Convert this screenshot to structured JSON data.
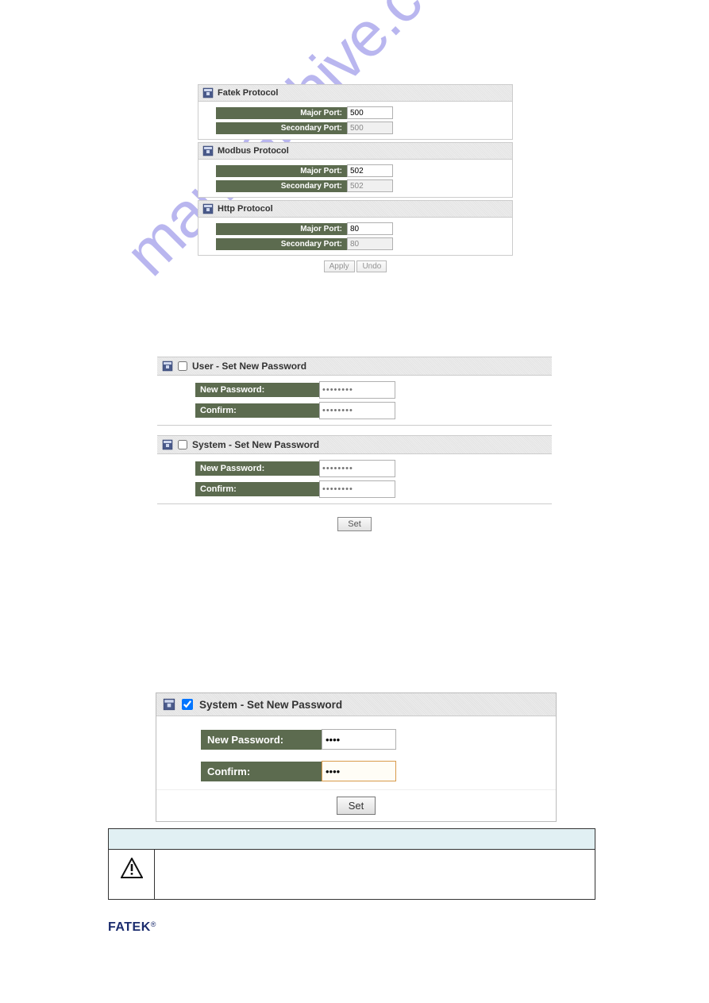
{
  "watermark": "manualshive.com",
  "protocol_panels": {
    "fatek": {
      "title": "Fatek Protocol",
      "major_label": "Major Port:",
      "major_value": "500",
      "secondary_label": "Secondary Port:",
      "secondary_value": "500"
    },
    "modbus": {
      "title": "Modbus Protocol",
      "major_label": "Major Port:",
      "major_value": "502",
      "secondary_label": "Secondary Port:",
      "secondary_value": "502"
    },
    "http": {
      "title": "Http Protocol",
      "major_label": "Major Port:",
      "major_value": "80",
      "secondary_label": "Secondary Port:",
      "secondary_value": "80"
    },
    "apply_label": "Apply",
    "undo_label": "Undo"
  },
  "password_panels_1": {
    "user": {
      "title": "User - Set New Password",
      "newpwd_label": "New Password:",
      "confirm_label": "Confirm:",
      "placeholder": "••••••••"
    },
    "system": {
      "title": "System - Set New Password",
      "newpwd_label": "New Password:",
      "confirm_label": "Confirm:",
      "placeholder": "••••••••"
    },
    "set_label": "Set"
  },
  "password_panel_2": {
    "title": "System - Set New Password",
    "newpwd_label": "New Password:",
    "newpwd_value": "••••",
    "confirm_label": "Confirm:",
    "confirm_value": "••••",
    "set_label": "Set"
  },
  "brand": {
    "text": "FATEK",
    "reg": "®"
  }
}
